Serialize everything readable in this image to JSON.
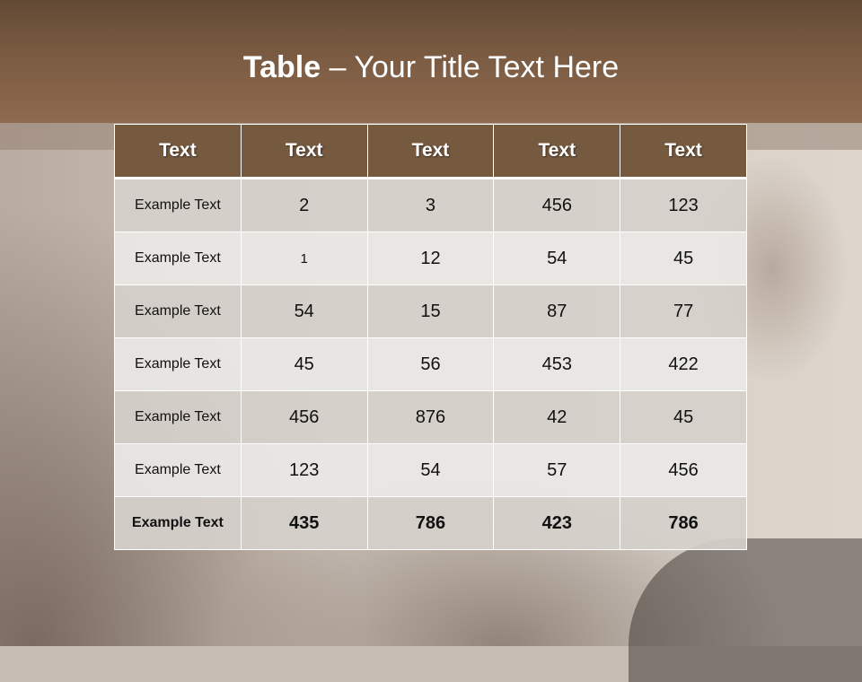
{
  "slide": {
    "title_bold": "Table",
    "title_rest": " – Your Title Text Here"
  },
  "table": {
    "headers": [
      "Text",
      "Text",
      "Text",
      "Text",
      "Text"
    ],
    "rows": [
      [
        "Example Text",
        "2",
        "3",
        "456",
        "123"
      ],
      [
        "Example Text",
        "1",
        "12",
        "54",
        "45"
      ],
      [
        "Example Text",
        "54",
        "15",
        "87",
        "77"
      ],
      [
        "Example Text",
        "45",
        "56",
        "453",
        "422"
      ],
      [
        "Example Text",
        "456",
        "876",
        "42",
        "45"
      ],
      [
        "Example Text",
        "123",
        "54",
        "57",
        "456"
      ],
      [
        "Example Text",
        "435",
        "786",
        "423",
        "786"
      ]
    ]
  },
  "colors": {
    "header_bar": "#7a5b42",
    "table_header": "#765a40"
  }
}
